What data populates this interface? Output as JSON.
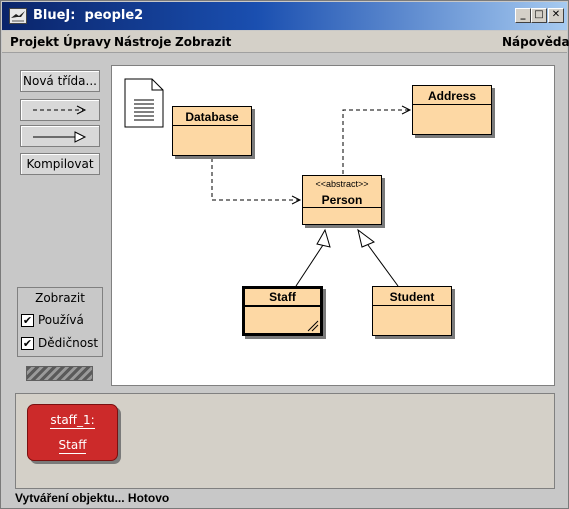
{
  "window": {
    "title": "BlueJ:  people2",
    "controls": {
      "minimize": "_",
      "maximize": "□",
      "close": "✕"
    }
  },
  "menubar": {
    "items": [
      "Projekt",
      "Úpravy",
      "Nástroje",
      "Zobrazit"
    ],
    "help": "Nápověda"
  },
  "tools": {
    "new_class": "Nová třída...",
    "uses_arrow": "uses-arrow-icon",
    "inherit_arrow": "inheritance-arrow-icon",
    "compile": "Kompilovat"
  },
  "view_panel": {
    "title": "Zobrazit",
    "options": [
      {
        "label": "Používá",
        "checked": true
      },
      {
        "label": "Dědičnost",
        "checked": true
      }
    ]
  },
  "diagram": {
    "readme_icon": "document-icon",
    "classes": [
      {
        "name": "Database",
        "stereotype": "",
        "selected": false
      },
      {
        "name": "Address",
        "stereotype": "",
        "selected": false
      },
      {
        "name": "Person",
        "stereotype": "<<abstract>>",
        "selected": false
      },
      {
        "name": "Staff",
        "stereotype": "",
        "selected": true
      },
      {
        "name": "Student",
        "stereotype": "",
        "selected": false
      }
    ]
  },
  "object_bench": {
    "objects": [
      {
        "name": "staff_1:",
        "class": "Staff"
      }
    ]
  },
  "status": {
    "text": "Vytváření objektu... Hotovo"
  },
  "colors": {
    "class_fill": "#fdd8a4",
    "object_fill": "#cc2a2a",
    "title_bar": "#0a246a"
  }
}
